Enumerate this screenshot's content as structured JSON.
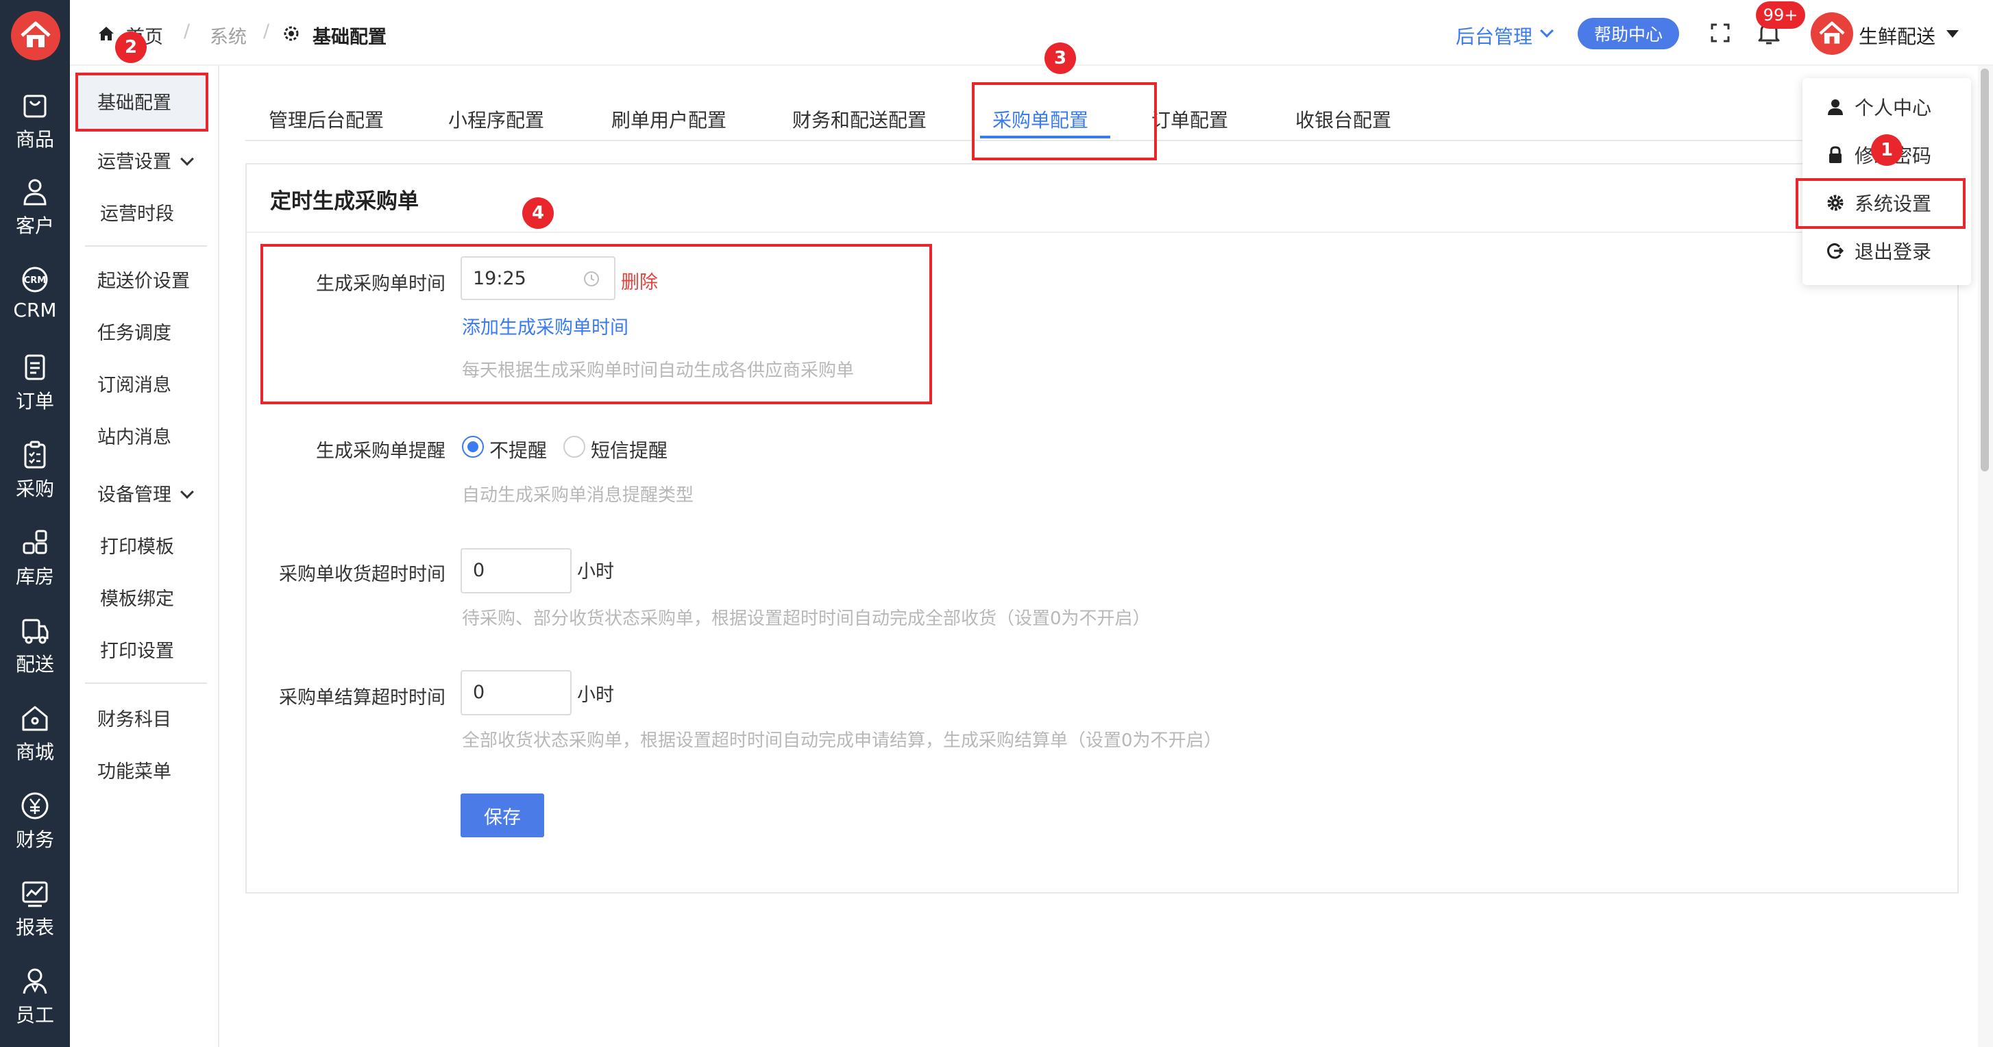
{
  "rail": {
    "items": [
      {
        "label": "商品",
        "icon": "bag-icon"
      },
      {
        "label": "客户",
        "icon": "person-icon"
      },
      {
        "label": "CRM",
        "icon": "crm-icon"
      },
      {
        "label": "订单",
        "icon": "document-icon"
      },
      {
        "label": "采购",
        "icon": "clipboard-icon"
      },
      {
        "label": "库房",
        "icon": "warehouse-icon"
      },
      {
        "label": "配送",
        "icon": "truck-icon"
      },
      {
        "label": "商城",
        "icon": "shop-icon"
      },
      {
        "label": "财务",
        "icon": "yen-icon"
      },
      {
        "label": "报表",
        "icon": "chart-icon"
      },
      {
        "label": "员工",
        "icon": "staff-icon"
      }
    ]
  },
  "breadcrumb": {
    "home": "首页",
    "system": "系统",
    "current": "基础配置"
  },
  "header": {
    "admin_menu": "后台管理",
    "help_center": "帮助中心",
    "notification_count": "99+",
    "user_name": "生鲜配送"
  },
  "sidebar": {
    "basic_config": "基础配置",
    "operation_settings": "运营设置",
    "operation_hours": "运营时段",
    "min_delivery_price": "起送价设置",
    "task_schedule": "任务调度",
    "subscription_msg": "订阅消息",
    "site_msg": "站内消息",
    "device_mgmt": "设备管理",
    "print_template": "打印模板",
    "template_binding": "模板绑定",
    "print_settings": "打印设置",
    "finance_subjects": "财务科目",
    "function_menu": "功能菜单"
  },
  "tabs": [
    "管理后台配置",
    "小程序配置",
    "刷单用户配置",
    "财务和配送配置",
    "采购单配置",
    "订单配置",
    "收银台配置"
  ],
  "panel": {
    "title": "定时生成采购单",
    "gen_time_label": "生成采购单时间",
    "gen_time_value": "19:25",
    "delete_link": "删除",
    "add_time_link": "添加生成采购单时间",
    "gen_time_hint": "每天根据生成采购单时间自动生成各供应商采购单",
    "reminder_label": "生成采购单提醒",
    "reminder_options": [
      "不提醒",
      "短信提醒"
    ],
    "reminder_selected": "不提醒",
    "reminder_hint": "自动生成采购单消息提醒类型",
    "receive_timeout_label": "采购单收货超时时间",
    "receive_timeout_value": "0",
    "receive_timeout_unit": "小时",
    "receive_timeout_hint": "待采购、部分收货状态采购单，根据设置超时时间自动完成全部收货（设置0为不开启）",
    "settle_timeout_label": "采购单结算超时时间",
    "settle_timeout_value": "0",
    "settle_timeout_unit": "小时",
    "settle_timeout_hint": "全部收货状态采购单，根据设置超时时间自动完成申请结算，生成采购结算单（设置0为不开启）",
    "save_button": "保存"
  },
  "user_menu": {
    "profile": "个人中心",
    "change_password": "修改密码",
    "system_settings": "系统设置",
    "logout": "退出登录"
  },
  "annotations": [
    "1",
    "2",
    "3",
    "4"
  ],
  "colors": {
    "rail_bg": "#222d3e",
    "accent": "#3a7bf0",
    "annotation_red": "#e8262c",
    "save_button": "#4a7be6"
  }
}
